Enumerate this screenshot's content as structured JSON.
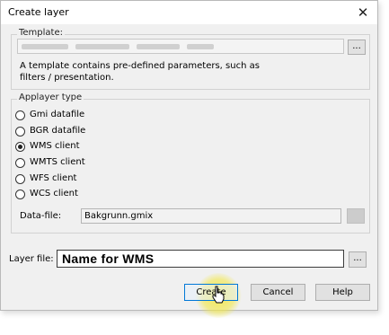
{
  "window": {
    "title": "Create layer",
    "close_glyph": "✕"
  },
  "template": {
    "group_label": "Template:",
    "browse_label": "...",
    "description_line1": "A template contains pre-defined parameters, such as",
    "description_line2": "filters / presentation."
  },
  "layer_type": {
    "group_label": "Applayer type",
    "options": [
      {
        "label": "Gmi datafile",
        "selected": false
      },
      {
        "label": "BGR datafile",
        "selected": false
      },
      {
        "label": "WMS client",
        "selected": true
      },
      {
        "label": "WMTS client",
        "selected": false
      },
      {
        "label": "WFS client",
        "selected": false
      },
      {
        "label": "WCS client",
        "selected": false
      }
    ],
    "datafile_label": "Data-file:",
    "datafile_value": "Bakgrunn.gmix"
  },
  "layer_file": {
    "label": "Layer file:",
    "value": "Name for WMS",
    "browse_label": "..."
  },
  "buttons": {
    "create": "Create",
    "cancel": "Cancel",
    "help": "Help"
  },
  "colors": {
    "cursor_highlight": "#f2e84a",
    "dialog_bg": "#f0f0f0"
  }
}
